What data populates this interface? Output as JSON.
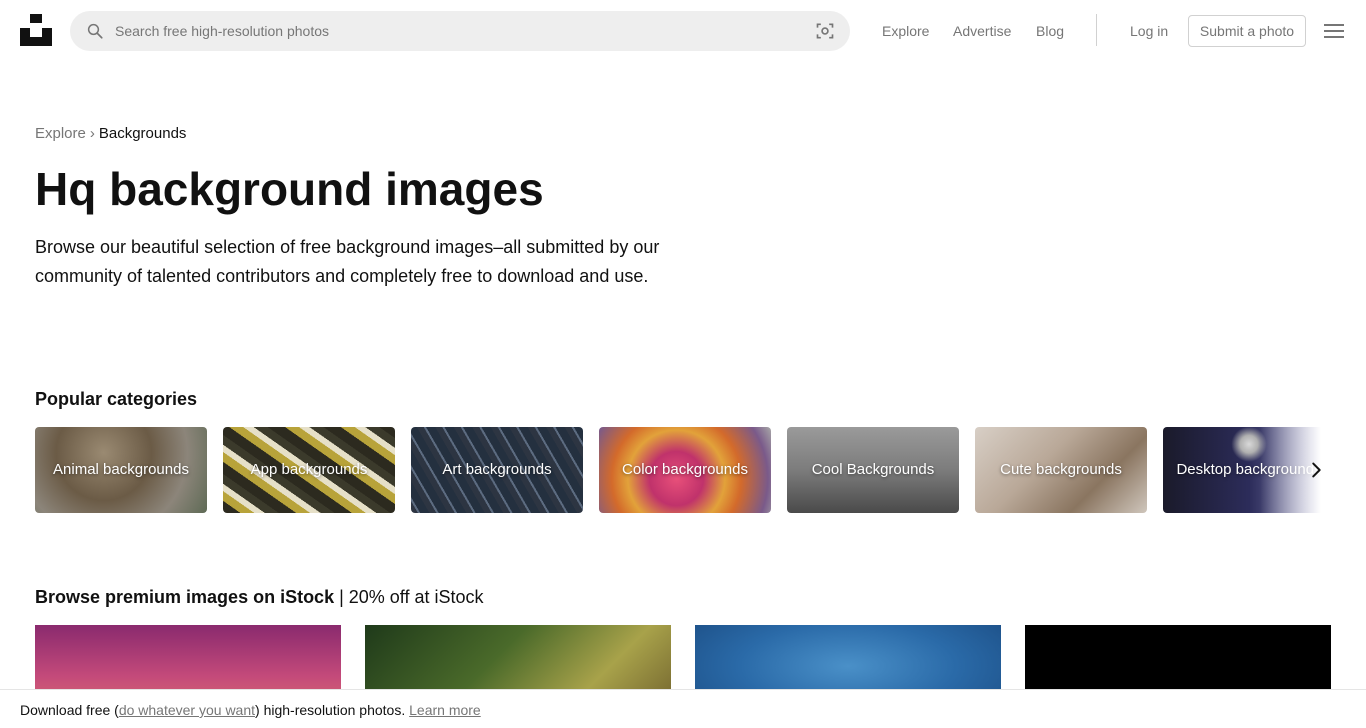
{
  "header": {
    "search_placeholder": "Search free high-resolution photos",
    "nav": [
      "Explore",
      "Advertise",
      "Blog"
    ],
    "login": "Log in",
    "submit": "Submit a photo"
  },
  "breadcrumb": {
    "parent": "Explore",
    "separator": "›",
    "current": "Backgrounds"
  },
  "page": {
    "title": "Hq background images",
    "description": "Browse our beautiful selection of free background images–all submitted by our community of talented contributors and completely free to download and use."
  },
  "categories": {
    "title": "Popular categories",
    "items": [
      "Animal backgrounds",
      "App backgrounds",
      "Art backgrounds",
      "Color backgrounds",
      "Cool Backgrounds",
      "Cute backgrounds",
      "Desktop backgrounds"
    ]
  },
  "istock": {
    "title_bold": "Browse premium images on iStock",
    "title_rest": " | 20% off at iStock"
  },
  "footer": {
    "prefix": "Download free (",
    "link": "do whatever you want",
    "suffix": ") high-resolution photos. ",
    "learn_more": "Learn more"
  },
  "colors": {
    "text_primary": "#111111",
    "text_secondary": "#767676",
    "search_bg": "#eeeeee",
    "border": "#d1d1d1"
  }
}
